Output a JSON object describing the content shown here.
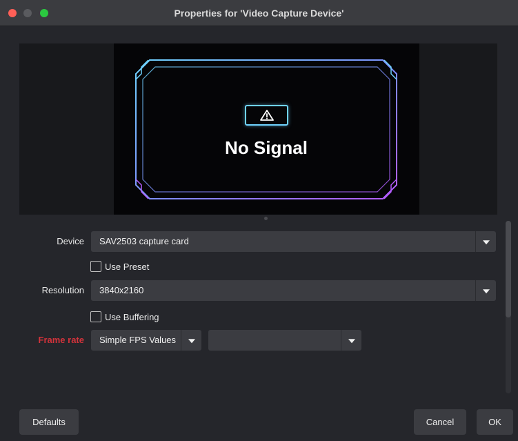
{
  "window": {
    "title": "Properties for 'Video Capture Device'"
  },
  "preview": {
    "message": "No Signal",
    "warning_icon": "warning-triangle-icon",
    "frame_colors": [
      "#6fd3ff",
      "#a05cff"
    ]
  },
  "form": {
    "device": {
      "label": "Device",
      "value": "SAV2503 capture card"
    },
    "use_preset": {
      "label": "Use Preset",
      "checked": false
    },
    "resolution": {
      "label": "Resolution",
      "value": "3840x2160"
    },
    "use_buffering": {
      "label": "Use Buffering",
      "checked": false
    },
    "frame_rate": {
      "label": "Frame rate",
      "mode_value": "Simple FPS Values",
      "fps_value": "",
      "label_color": "#d2333b"
    }
  },
  "buttons": {
    "defaults": "Defaults",
    "cancel": "Cancel",
    "ok": "OK"
  }
}
